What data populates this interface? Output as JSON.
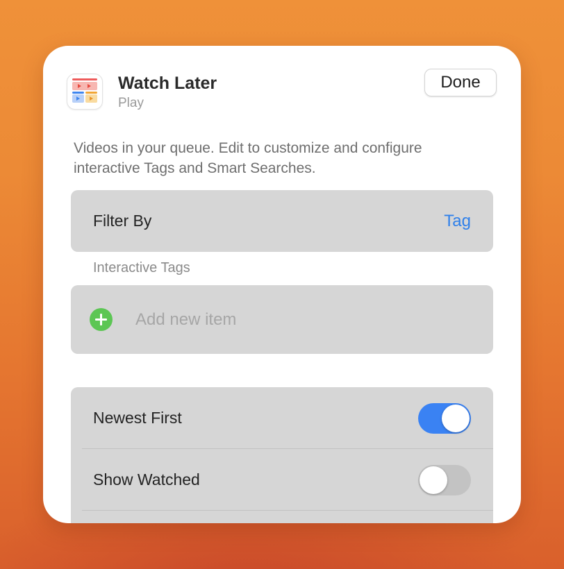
{
  "header": {
    "title": "Watch Later",
    "subtitle": "Play",
    "done_label": "Done",
    "app_icon": "play-app-icon"
  },
  "description": "Videos in your queue. Edit to customize and configure interactive Tags and Smart Searches.",
  "filter": {
    "label": "Filter By",
    "value": "Tag"
  },
  "interactive_tags": {
    "section_label": "Interactive Tags",
    "add_label": "Add new item",
    "add_icon": "plus-circle-icon"
  },
  "settings": [
    {
      "label": "Newest First",
      "enabled": true
    },
    {
      "label": "Show Watched",
      "enabled": false
    }
  ],
  "colors": {
    "accent": "#2f80ea",
    "toggle_on": "#3a82f3",
    "toggle_off": "#c3c3c3",
    "add_green": "#5cc654",
    "card_bg": "#d6d6d6"
  }
}
